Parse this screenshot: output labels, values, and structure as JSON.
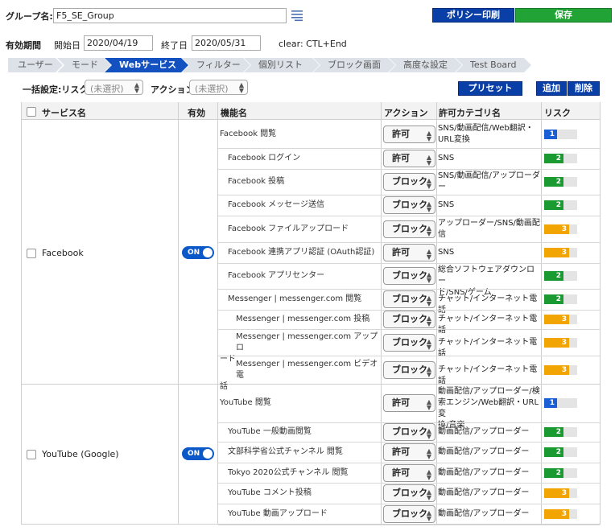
{
  "header": {
    "group_label": "グループ名:",
    "group_value": "F5_SE_Group",
    "policy_print": "ポリシー印刷",
    "save": "保存"
  },
  "period": {
    "label": "有効期間",
    "start_label": "開始日",
    "start_value": "2020/04/19",
    "end_label": "終了日",
    "end_value": "2020/05/31",
    "clear_hint": "clear: CTL+End"
  },
  "tabs": [
    "ユーザー",
    "モード",
    "Webサービス",
    "フィルター",
    "個別リスト",
    "ブロック画面",
    "高度な設定",
    "Test Board"
  ],
  "bulk": {
    "label": "一括設定:リスク",
    "risk_placeholder": "(未選択)",
    "action_label": "アクション",
    "action_placeholder": "(未選択)",
    "preset": "プリセット",
    "add": "追加",
    "delete": "削除"
  },
  "table": {
    "headers": [
      "サービス名",
      "有効",
      "機能名",
      "アクション",
      "許可カテゴリ名",
      "リスク"
    ],
    "services": [
      {
        "name": "Facebook",
        "toggle": "ON"
      },
      {
        "name": "YouTube (Google)",
        "toggle": "ON"
      }
    ],
    "rows": [
      {
        "fn1": "Facebook 閲覧",
        "fn2": "",
        "action": "許可",
        "cat1": "SNS/動画配信/Web翻訳・",
        "cat2": "URL変換",
        "risk": 1
      },
      {
        "fn1": "Facebook ログイン",
        "fn2": "",
        "action": "許可",
        "cat1": "SNS",
        "cat2": "",
        "risk": 2
      },
      {
        "fn1": "Facebook 投稿",
        "fn2": "",
        "action": "ブロック",
        "cat1": "SNS/動画配信/アップローダ",
        "cat2": "ー",
        "risk": 2
      },
      {
        "fn1": "Facebook メッセージ送信",
        "fn2": "",
        "action": "ブロック",
        "cat1": "SNS",
        "cat2": "",
        "risk": 2
      },
      {
        "fn1": "Facebook ファイルアップロード",
        "fn2": "",
        "action": "ブロック",
        "cat1": "アップローダー/SNS/動画配",
        "cat2": "信",
        "risk": 3
      },
      {
        "fn1": "Facebook 連携アプリ認証 (OAuth認証)",
        "fn2": "",
        "action": "許可",
        "cat1": "SNS",
        "cat2": "",
        "risk": 3
      },
      {
        "fn1": "Facebook アプリセンター",
        "fn2": "",
        "action": "ブロック",
        "cat1": "総合ソフトウェアダウンロー",
        "cat2": "ド/SNS/ゲーム",
        "risk": 2
      },
      {
        "fn1": "Messenger | messenger.com 閲覧",
        "fn2": "",
        "action": "ブロック",
        "cat1": "チャット/インターネット電話",
        "cat2": "",
        "risk": 2
      },
      {
        "fn1": "Messenger | messenger.com 投稿",
        "fn2": "",
        "action": "ブロック",
        "cat1": "チャット/インターネット電話",
        "cat2": "",
        "risk": 3
      },
      {
        "fn1": "Messenger | messenger.com アップロ",
        "fn2": "ード",
        "action": "ブロック",
        "cat1": "チャット/インターネット電話",
        "cat2": "",
        "risk": 3
      },
      {
        "fn1": "Messenger | messenger.com ビデオ電",
        "fn2": "話",
        "action": "ブロック",
        "cat1": "チャット/インターネット電話",
        "cat2": "",
        "risk": 3
      },
      {
        "fn1": "YouTube 閲覧",
        "fn2": "",
        "action": "許可",
        "cat1": "動画配信/アップローダー/検",
        "cat2": "索エンジン/Web翻訳・URL変",
        "cat3": "換/音楽",
        "risk": 1
      },
      {
        "fn1": "YouTube 一般動画閲覧",
        "fn2": "",
        "action": "ブロック",
        "cat1": "動画配信/アップローダー",
        "cat2": "",
        "risk": 2
      },
      {
        "fn1": "文部科学省公式チャンネル 閲覧",
        "fn2": "",
        "action": "許可",
        "cat1": "動画配信/アップローダー",
        "cat2": "",
        "risk": 2
      },
      {
        "fn1": "Tokyo 2020公式チャンネル 閲覧",
        "fn2": "",
        "action": "許可",
        "cat1": "動画配信/アップローダー",
        "cat2": "",
        "risk": 2
      },
      {
        "fn1": "YouTube コメント投稿",
        "fn2": "",
        "action": "ブロック",
        "cat1": "動画配信/アップローダー",
        "cat2": "",
        "risk": 3
      },
      {
        "fn1": "YouTube 動画アップロード",
        "fn2": "",
        "action": "ブロック",
        "cat1": "動画配信/アップローダー",
        "cat2": "",
        "risk": 3
      }
    ]
  }
}
